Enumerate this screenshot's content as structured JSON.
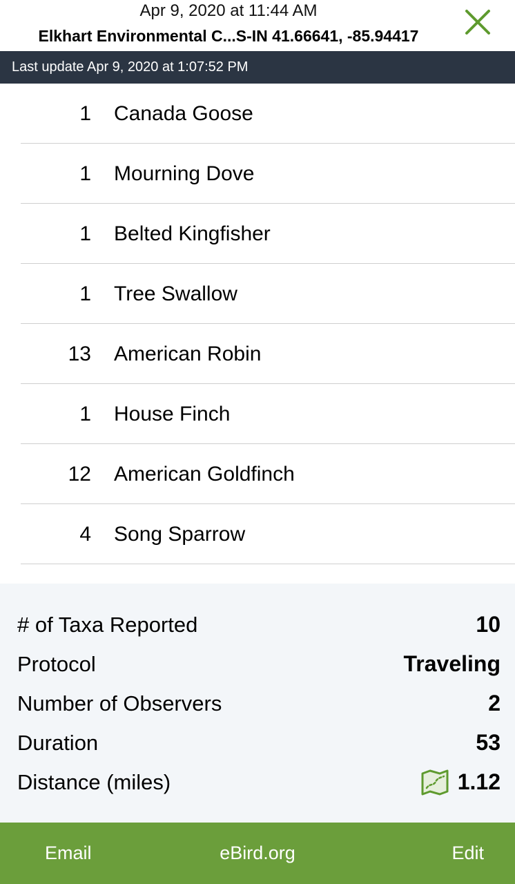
{
  "header": {
    "date": "Apr 9, 2020 at 11:44 AM",
    "location": "Elkhart Environmental C...S-IN 41.66641, -85.94417",
    "close_icon": "close-x-icon"
  },
  "update_bar": {
    "text": "Last update Apr 9, 2020 at 1:07:52 PM"
  },
  "species": [
    {
      "count": "1",
      "name": "Canada Goose"
    },
    {
      "count": "1",
      "name": "Mourning Dove"
    },
    {
      "count": "1",
      "name": "Belted Kingfisher"
    },
    {
      "count": "1",
      "name": "Tree Swallow"
    },
    {
      "count": "13",
      "name": "American Robin"
    },
    {
      "count": "1",
      "name": "House Finch"
    },
    {
      "count": "12",
      "name": "American Goldfinch"
    },
    {
      "count": "4",
      "name": "Song Sparrow"
    }
  ],
  "summary": {
    "taxa_label": "# of Taxa Reported",
    "taxa_value": "10",
    "protocol_label": "Protocol",
    "protocol_value": "Traveling",
    "observers_label": "Number of Observers",
    "observers_value": "2",
    "duration_label": "Duration",
    "duration_value": "53",
    "distance_label": "Distance (miles)",
    "distance_value": "1.12",
    "distance_icon": "map-track-icon"
  },
  "toolbar": {
    "email_label": "Email",
    "ebird_label": "eBird.org",
    "edit_label": "Edit"
  },
  "colors": {
    "accent_green": "#6b9e3b",
    "update_bar_bg": "#2b3543",
    "summary_bg": "#f3f6f9"
  }
}
